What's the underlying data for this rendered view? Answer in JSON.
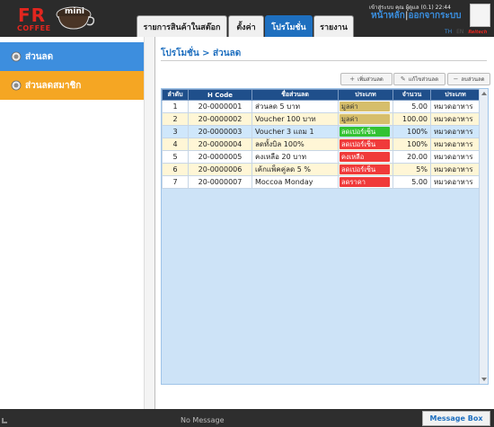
{
  "header": {
    "logo_text": "FR",
    "logo_sub": "COFFEE",
    "logo_mini": "mini",
    "tabs": [
      {
        "label": "รายการสินค้าในสต๊อก"
      },
      {
        "label": "ตั้งค่า"
      },
      {
        "label": "โปรโมชั่น"
      },
      {
        "label": "รายงาน"
      }
    ],
    "user_line": "เข้าสู่ระบบ คุณ ผู้ดูแล (0.1) 22:44",
    "home_link": "หน้าหลัก",
    "logout_link": "ออกจากระบบ",
    "lang_th": "TH",
    "lang_en": "EN",
    "brand_small": "Reitech"
  },
  "sidebar": {
    "items": [
      {
        "label": "ส่วนลด"
      },
      {
        "label": "ส่วนลดสมาชิก"
      }
    ]
  },
  "main": {
    "breadcrumb": "โปรโมชั่น > ส่วนลด",
    "toolbar": {
      "add_label": "เพิ่มส่วนลด",
      "edit_label": "แก้ไขส่วนลด",
      "delete_label": "ลบส่วนลด"
    },
    "table": {
      "columns": [
        "ลำดับ",
        "H Code",
        "ชื่อส่วนลด",
        "ประเภท",
        "จำนวน",
        "ประเภท"
      ],
      "rows": [
        {
          "no": "1",
          "code": "20-0000001",
          "name": "ส่วนลด 5 บาท",
          "type": "มูลค่า",
          "type_color": "#d6be6b",
          "amount": "5.00",
          "category": "หมวดอาหาร"
        },
        {
          "no": "2",
          "code": "20-0000002",
          "name": "Voucher 100 บาท",
          "type": "มูลค่า",
          "type_color": "#d6be6b",
          "amount": "100.00",
          "category": "หมวดอาหาร"
        },
        {
          "no": "3",
          "code": "20-0000003",
          "name": "Voucher 3 แถม 1",
          "type": "ลดเปอร์เซ็น",
          "type_color": "#33c233",
          "amount": "100%",
          "category": "หมวดอาหาร"
        },
        {
          "no": "4",
          "code": "20-0000004",
          "name": "ลดทั้งบิล 100%",
          "type": "ลดเปอร์เซ็น",
          "type_color": "#f03a3a",
          "amount": "100%",
          "category": "หมวดอาหาร"
        },
        {
          "no": "5",
          "code": "20-0000005",
          "name": "คงเหลือ 20 บาท",
          "type": "คงเหลือ",
          "type_color": "#f03a3a",
          "amount": "20.00",
          "category": "หมวดอาหาร"
        },
        {
          "no": "6",
          "code": "20-0000006",
          "name": "เค้กแพ็คคู่ลด 5 %",
          "type": "ลดเปอร์เซ็น",
          "type_color": "#f03a3a",
          "amount": "5%",
          "category": "หมวดอาหาร"
        },
        {
          "no": "7",
          "code": "20-0000007",
          "name": "Moccoa Monday",
          "type": "ลดราคา",
          "type_color": "#f03a3a",
          "amount": "5.00",
          "category": "หมวดอาหาร"
        }
      ]
    }
  },
  "footer": {
    "status": "No Message",
    "message_box": "Message Box"
  },
  "colors": {
    "header_bg": "#2b2b2b",
    "accent_blue": "#1e6fbf",
    "sidebar_active": "#3d8ede",
    "sidebar_orange": "#f5a623",
    "table_header": "#1f4f8b"
  }
}
